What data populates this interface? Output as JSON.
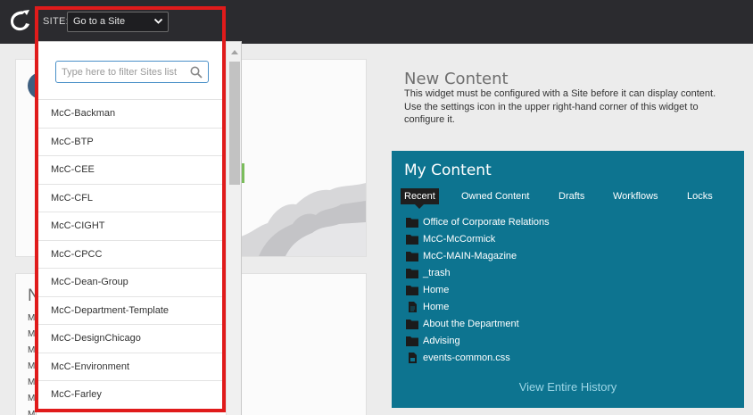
{
  "header": {
    "site_label": "SITE:",
    "site_select_value": "Go to a Site"
  },
  "site_dropdown": {
    "filter_placeholder": "Type here to filter Sites list",
    "sites": [
      "McC-Backman",
      "McC-BTP",
      "McC-CEE",
      "McC-CFL",
      "McC-CIGHT",
      "McC-CPCC",
      "McC-Dean-Group",
      "McC-Department-Template",
      "McC-DesignChicago",
      "McC-Environment",
      "McC-Farley"
    ]
  },
  "left_panel": {
    "card2_title": "N",
    "card2_lines": [
      "M",
      "M",
      "M",
      "M",
      "M",
      "M",
      "M"
    ]
  },
  "new_content": {
    "title": "New Content",
    "message": "This widget must be configured with a Site before it can display content. Use the settings icon in the upper right-hand corner of this widget to configure it."
  },
  "my_content": {
    "title": "My Content",
    "tabs": [
      "Recent",
      "Owned Content",
      "Drafts",
      "Workflows",
      "Locks"
    ],
    "active_tab": "Recent",
    "items": [
      {
        "label": "Office of Corporate Relations",
        "icon": "folder-icon"
      },
      {
        "label": "McC-McCormick",
        "icon": "folder-icon"
      },
      {
        "label": "McC-MAIN-Magazine",
        "icon": "folder-icon"
      },
      {
        "label": "_trash",
        "icon": "folder-icon"
      },
      {
        "label": "Home",
        "icon": "folder-icon"
      },
      {
        "label": "Home",
        "icon": "document-icon"
      },
      {
        "label": "About the Department",
        "icon": "folder-icon"
      },
      {
        "label": "Advising",
        "icon": "folder-icon"
      },
      {
        "label": "events-common.css",
        "icon": "file-icon"
      }
    ],
    "history_link": "View Entire History"
  },
  "colors": {
    "topbar": "#2b2b2f",
    "my_content_bg": "#0d7490",
    "highlight": "#e01b1b",
    "filter_border": "#4a90c8"
  }
}
